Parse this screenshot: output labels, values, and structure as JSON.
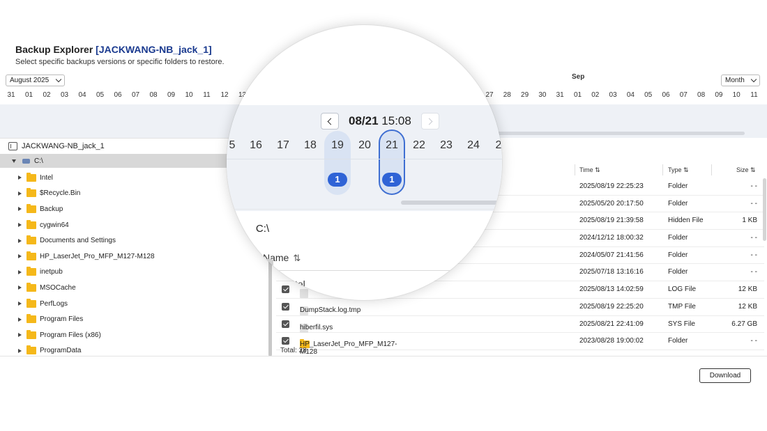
{
  "header": {
    "title_prefix": "Backup Explorer ",
    "title_ident": "[JACKWANG-NB_jack_1]",
    "subtitle": "Select specific backups versions or specific folders to restore."
  },
  "calendar": {
    "month_select": "August 2025",
    "next_month_label": "Sep",
    "range_select": "Month",
    "days_left": [
      "31",
      "01",
      "02",
      "03",
      "04",
      "05",
      "06",
      "07",
      "08",
      "09",
      "10",
      "11",
      "12",
      "13"
    ],
    "days_right": [
      "27",
      "28",
      "29",
      "30",
      "31",
      "01",
      "02",
      "03",
      "04",
      "05",
      "06",
      "07",
      "08",
      "09",
      "10",
      "11"
    ]
  },
  "magnifier": {
    "date": "08/21",
    "time": "15:08",
    "days": [
      "5",
      "16",
      "17",
      "18",
      "19",
      "20",
      "21",
      "22",
      "23",
      "24",
      "2"
    ],
    "badge_19": "1",
    "badge_21": "1",
    "path_icon": "⟩",
    "path": "C:\\",
    "name_header": "Name",
    "sort_icon": "⇅",
    "partial_row": "tel"
  },
  "tree": {
    "root": "JACKWANG-NB_jack_1",
    "drive": "C:\\",
    "folders": [
      "Intel",
      "$Recycle.Bin",
      "Backup",
      "cygwin64",
      "Documents and Settings",
      "HP_LaserJet_Pro_MFP_M127-M128",
      "inetpub",
      "MSOCache",
      "PerfLogs",
      "Program Files",
      "Program Files (x86)",
      "ProgramData"
    ]
  },
  "grid": {
    "headers": {
      "time": "Time ⇅",
      "type": "Type ⇅",
      "size": "Size ⇅"
    },
    "rows": [
      {
        "name": "",
        "time": "2025/08/19 22:25:23",
        "type": "Folder",
        "size": "- -",
        "checked": false,
        "kind": "hidden"
      },
      {
        "name": "",
        "time": "2025/05/20 20:17:50",
        "type": "Folder",
        "size": "- -",
        "checked": false,
        "kind": "hidden"
      },
      {
        "name": "",
        "time": "2025/08/19 21:39:58",
        "type": "Hidden File",
        "size": "1 KB",
        "checked": false,
        "kind": "hidden"
      },
      {
        "name": "",
        "time": "2024/12/12 18:00:32",
        "type": "Folder",
        "size": "- -",
        "checked": false,
        "kind": "hidden"
      },
      {
        "name": "",
        "time": "2024/05/07 21:41:56",
        "type": "Folder",
        "size": "- -",
        "checked": false,
        "kind": "hidden"
      },
      {
        "name": "",
        "time": "2025/07/18 13:16:16",
        "type": "Folder",
        "size": "- -",
        "checked": false,
        "kind": "hidden"
      },
      {
        "name": "",
        "time": "2025/08/13 14:02:59",
        "type": "LOG File",
        "size": "12 KB",
        "checked": true,
        "kind": "file"
      },
      {
        "name": "DumpStack.log.tmp",
        "time": "2025/08/19 22:25:20",
        "type": "TMP File",
        "size": "12 KB",
        "checked": true,
        "kind": "file"
      },
      {
        "name": "hiberfil.sys",
        "time": "2025/08/21 22:41:09",
        "type": "SYS File",
        "size": "6.27 GB",
        "checked": true,
        "kind": "file"
      },
      {
        "name": "HP_LaserJet_Pro_MFP_M127-M128",
        "time": "2023/08/28 19:00:02",
        "type": "Folder",
        "size": "- -",
        "checked": true,
        "kind": "folder"
      }
    ],
    "total": "Total: 28"
  },
  "actions": {
    "download": "Download"
  }
}
